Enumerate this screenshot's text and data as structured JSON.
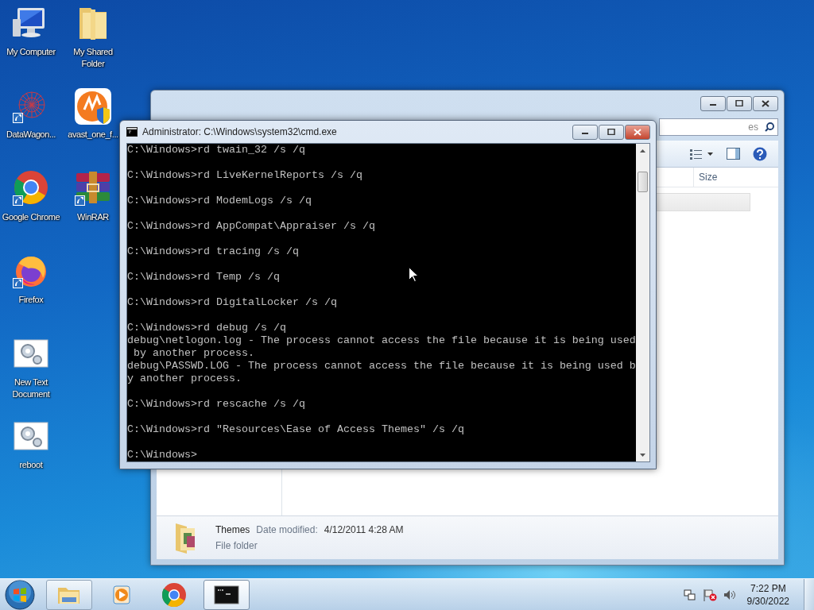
{
  "desktop_columns": [
    [
      {
        "label": "My Computer",
        "kind": "computer",
        "shortcut": false
      },
      {
        "label": "DataWagon...",
        "kind": "web",
        "shortcut": true
      },
      {
        "label": "Google Chrome",
        "kind": "chrome",
        "shortcut": true
      },
      {
        "label": "Firefox",
        "kind": "firefox",
        "shortcut": true
      },
      {
        "label": "New Text Document",
        "kind": "script",
        "shortcut": false
      },
      {
        "label": "reboot",
        "kind": "script",
        "shortcut": false
      }
    ],
    [
      {
        "label": "My Shared Folder",
        "kind": "folder",
        "shortcut": false
      },
      {
        "label": "avast_one_f...",
        "kind": "avast",
        "shortcut": false
      },
      {
        "label": "WinRAR",
        "kind": "winrar",
        "shortcut": true
      }
    ]
  ],
  "explorer": {
    "search_placeholder": "es",
    "columns": [
      "Size"
    ],
    "details": {
      "name": "Themes",
      "date_label": "Date modified:",
      "date_value": "4/12/2011 4:28 AM",
      "type": "File folder"
    }
  },
  "cmd": {
    "title": "Administrator: C:\\Windows\\system32\\cmd.exe",
    "entries": [
      {
        "line": "C:\\Windows>rd twain_32 /s /q"
      },
      {
        "line": "C:\\Windows>rd LiveKernelReports /s /q"
      },
      {
        "line": "C:\\Windows>rd ModemLogs /s /q"
      },
      {
        "line": "C:\\Windows>rd AppCompat\\Appraiser /s /q"
      },
      {
        "line": "C:\\Windows>rd tracing /s /q"
      },
      {
        "line": "C:\\Windows>rd Temp /s /q"
      },
      {
        "line": "C:\\Windows>rd DigitalLocker /s /q"
      },
      {
        "line": "C:\\Windows>rd debug /s /q",
        "output": [
          "debug\\netlogon.log - The process cannot access the file because it is being used",
          " by another process.",
          "debug\\PASSWD.LOG - The process cannot access the file because it is being used b",
          "y another process."
        ]
      },
      {
        "line": "C:\\Windows>rd rescache /s /q"
      },
      {
        "line": "C:\\Windows>rd \"Resources\\Ease of Access Themes\" /s /q"
      },
      {
        "line": "C:\\Windows>"
      }
    ]
  },
  "taskbar": {
    "items": [
      {
        "kind": "explorer",
        "open": true,
        "active": false
      },
      {
        "kind": "media",
        "open": false,
        "active": false
      },
      {
        "kind": "chrome",
        "open": false,
        "active": false
      },
      {
        "kind": "console",
        "open": true,
        "active": true
      }
    ],
    "time": "7:22 PM",
    "date": "9/30/2022"
  }
}
